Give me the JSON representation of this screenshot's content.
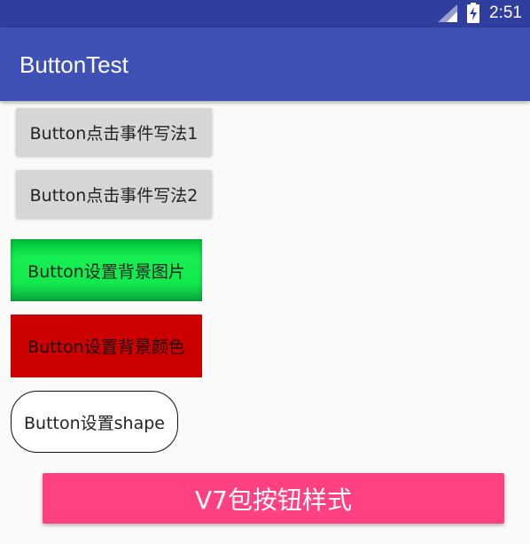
{
  "status_bar": {
    "time": "2:51",
    "icons": [
      "signal-icon",
      "battery-charging-icon"
    ]
  },
  "app_bar": {
    "title": "ButtonTest"
  },
  "buttons": [
    {
      "label": "Button点击事件写法1"
    },
    {
      "label": "Button点击事件写法2"
    },
    {
      "label": "Button设置背景图片"
    },
    {
      "label": "Button设置背景颜色"
    },
    {
      "label": "Button设置shape"
    },
    {
      "label": "V7包按钮样式"
    }
  ],
  "colors": {
    "status_bar": "#303f9f",
    "app_bar": "#3f51b5",
    "background": "#fafafa",
    "default_button": "#d6d6d6",
    "image_button_green": "#13ea4d",
    "color_button_red": "#cc0000",
    "v7_button_accent": "#ff4081"
  }
}
